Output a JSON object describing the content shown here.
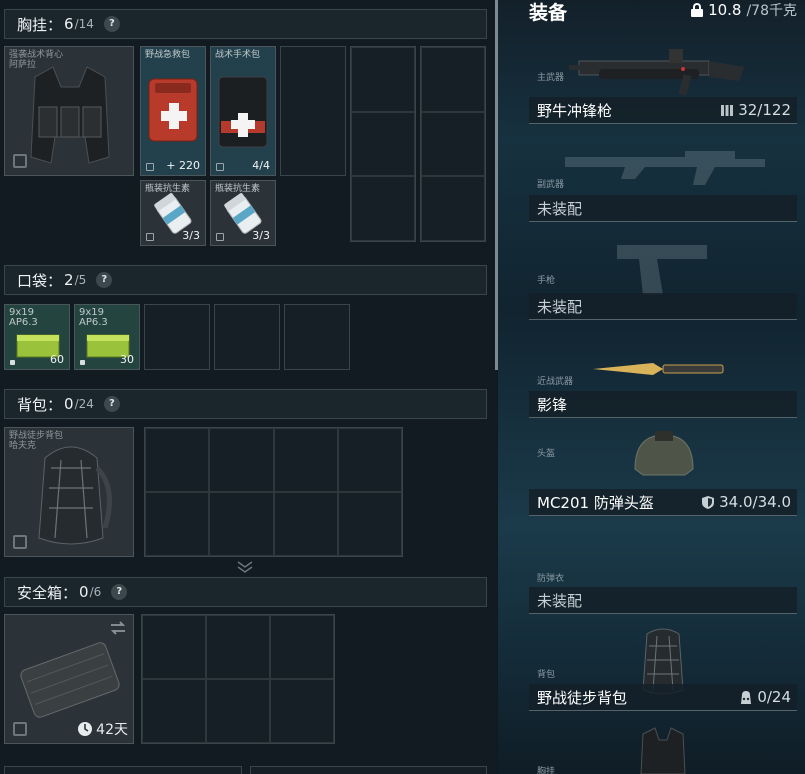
{
  "chest_rig": {
    "title": "胸挂：",
    "count": "6",
    "capacity": "/14",
    "help": "?",
    "rig_label": "强袭战术背心\n阿萨拉",
    "items": [
      {
        "label": "野战急救包",
        "qty": "220",
        "qty_prefix": "+"
      },
      {
        "label": "战术手术包",
        "qty": "4/4"
      },
      {
        "label": "瓶装抗生素",
        "qty": "3/3"
      },
      {
        "label": "瓶装抗生素",
        "qty": "3/3"
      }
    ]
  },
  "pocket": {
    "title": "口袋：",
    "count": "2",
    "capacity": "/5",
    "help": "?",
    "items": [
      {
        "label": "9x19\nAP6.3",
        "qty": "60"
      },
      {
        "label": "9x19\nAP6.3",
        "qty": "30"
      }
    ]
  },
  "backpack": {
    "title": "背包：",
    "count": "0",
    "capacity": "/24",
    "help": "?",
    "bag_label": "野战徒步背包\n哈夫克"
  },
  "safe_box": {
    "title": "安全箱：",
    "count": "0",
    "capacity": "/6",
    "help": "?",
    "timer": "42天"
  },
  "equipment": {
    "title": "装备",
    "weight": "10.8",
    "weight_cap": "/78千克",
    "slots": [
      {
        "sub": "主武器",
        "name": "野牛冲锋枪",
        "value": "32/122",
        "icon": "ammo-icon"
      },
      {
        "sub": "副武器",
        "name": "未装配"
      },
      {
        "sub": "手枪",
        "name": "未装配"
      },
      {
        "sub": "近战武器",
        "name": "影锋"
      },
      {
        "sub": "头盔",
        "name": "MC201 防弹头盔",
        "value": "34.0/34.0",
        "icon": "shield-icon"
      },
      {
        "sub": "防弹衣",
        "name": "未装配"
      },
      {
        "sub": "背包",
        "name": "野战徒步背包",
        "value": "0/24",
        "icon": "bag-icon"
      },
      {
        "sub": "胸挂"
      }
    ]
  }
}
